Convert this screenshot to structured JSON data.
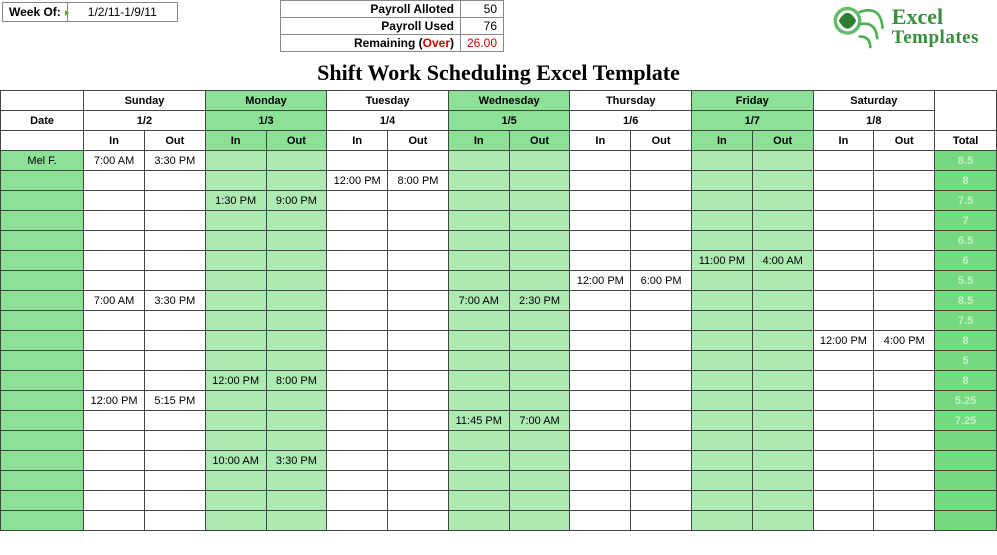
{
  "week_of_label": "Week Of:",
  "week_of_value": "1/2/11-1/9/11",
  "payroll": {
    "alloted_label": "Payroll Alloted",
    "alloted_value": "50",
    "used_label": "Payroll Used",
    "used_value": "76",
    "remaining_label_a": "Remaining (",
    "remaining_label_b": "Over",
    "remaining_label_c": ")",
    "remaining_value": "26.00"
  },
  "logo": {
    "line1": "Excel",
    "line2": "Templates"
  },
  "title": "Shift Work Scheduling Excel Template",
  "date_label": "Date",
  "days": [
    "Sunday",
    "Monday",
    "Tuesday",
    "Wednesday",
    "Thursday",
    "Friday",
    "Saturday"
  ],
  "green_days": [
    false,
    true,
    false,
    true,
    false,
    true,
    false
  ],
  "dates": [
    "1/2",
    "1/3",
    "1/4",
    "1/5",
    "1/6",
    "1/7",
    "1/8"
  ],
  "io": {
    "in": "In",
    "out": "Out"
  },
  "total_label": "Total",
  "row_labels": [
    "Mel F.",
    "",
    "",
    "",
    "",
    "",
    "",
    "",
    "",
    "",
    "",
    "",
    "",
    "",
    "",
    "",
    "",
    "",
    ""
  ],
  "totals": [
    "8.5",
    "8",
    "7.5",
    "7",
    "6.5",
    "6",
    "5.5",
    "8.5",
    "7.5",
    "8",
    "5",
    "8",
    "5.25",
    "7.25",
    "",
    "",
    "",
    "",
    ""
  ],
  "cells": {
    "r0c0": "7:00 AM",
    "r0c1": "3:30 PM",
    "r1c4": "12:00 PM",
    "r1c5": "8:00 PM",
    "r2c2": "1:30 PM",
    "r2c3": "9:00 PM",
    "r5c10": "11:00 PM",
    "r5c11": "4:00 AM",
    "r6c8": "12:00 PM",
    "r6c9": "6:00 PM",
    "r7c0": "7:00 AM",
    "r7c1": "3:30 PM",
    "r7c6": "7:00 AM",
    "r7c7": "2:30 PM",
    "r9c12": "12:00 PM",
    "r9c13": "4:00 PM",
    "r11c2": "12:00 PM",
    "r11c3": "8:00 PM",
    "r12c0": "12:00 PM",
    "r12c1": "5:15 PM",
    "r13c6": "11:45 PM",
    "r13c7": "7:00 AM",
    "r15c2": "10:00 AM",
    "r15c3": "3:30 PM"
  }
}
